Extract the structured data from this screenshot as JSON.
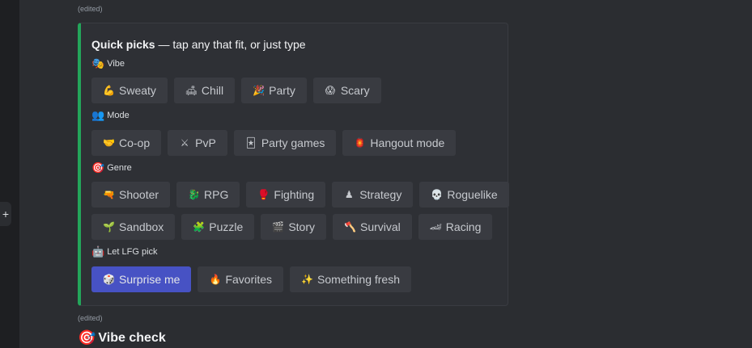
{
  "top_edited": "(edited)",
  "embed": {
    "title_bold": "Quick picks",
    "title_rest": " — tap any that fit, or just type",
    "accent_color": "#23a55a",
    "sections": {
      "vibe": {
        "icon": "🎭",
        "label": "Vibe",
        "buttons": [
          {
            "icon": "💪",
            "label": "Sweaty"
          },
          {
            "icon": "🛋",
            "label": "Chill"
          },
          {
            "icon": "🎉",
            "label": "Party"
          },
          {
            "icon": "😱",
            "label": "Scary"
          }
        ]
      },
      "mode": {
        "icon": "👥",
        "label": "Mode",
        "buttons": [
          {
            "icon": "🤝",
            "label": "Co-op"
          },
          {
            "icon": "⚔",
            "label": "PvP"
          },
          {
            "icon": "🃏",
            "label": "Party games"
          },
          {
            "icon": "🏮",
            "label": "Hangout mode"
          }
        ]
      },
      "genre": {
        "icon": "🎯",
        "label": "Genre",
        "buttons_row1": [
          {
            "icon": "🔫",
            "label": "Shooter"
          },
          {
            "icon": "🐉",
            "label": "RPG"
          },
          {
            "icon": "🥊",
            "label": "Fighting"
          },
          {
            "icon": "♟",
            "label": "Strategy"
          },
          {
            "icon": "💀",
            "label": "Roguelike"
          }
        ],
        "buttons_row2": [
          {
            "icon": "🌱",
            "label": "Sandbox"
          },
          {
            "icon": "🧩",
            "label": "Puzzle"
          },
          {
            "icon": "🎬",
            "label": "Story"
          },
          {
            "icon": "🪓",
            "label": "Survival"
          },
          {
            "icon": "🏎",
            "label": "Racing"
          }
        ]
      },
      "lfg": {
        "icon": "🤖",
        "label": "Let LFG pick",
        "buttons": [
          {
            "icon": "🎲",
            "label": "Surprise me",
            "primary": true
          },
          {
            "icon": "🔥",
            "label": "Favorites"
          },
          {
            "icon": "✨",
            "label": "Something fresh"
          }
        ]
      }
    }
  },
  "bottom_edited": "(edited)",
  "vibe_check": {
    "icon": "🎯",
    "text": "Vibe check"
  }
}
